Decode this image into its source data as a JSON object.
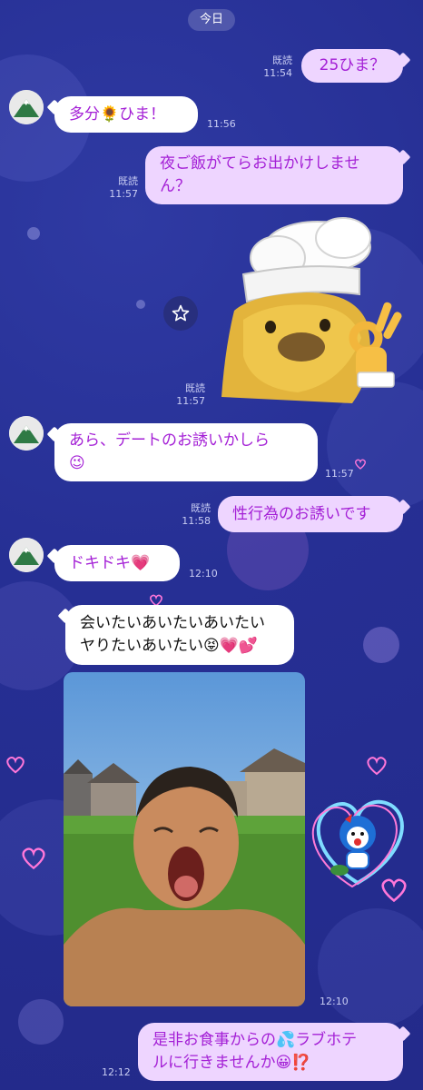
{
  "date_label": "今日",
  "messages": [
    {
      "side": "me",
      "text": "25ひま？",
      "read": "既読",
      "time": "11:54"
    },
    {
      "side": "them",
      "text": "多分🌻ひま！",
      "time": "11:56"
    },
    {
      "side": "me",
      "line1": "夜ご飯がてらお出かけしませ",
      "line2": "ん？",
      "read": "既読",
      "time": "11:57"
    },
    {
      "side": "me",
      "type": "sticker",
      "read": "既読",
      "time": "11:57"
    },
    {
      "side": "them",
      "line1": "あら、デートのお誘いかしら",
      "line2": "😉",
      "time": "11:57"
    },
    {
      "side": "me",
      "text": "性行為のお誘いです",
      "read": "既読",
      "time": "11:58"
    },
    {
      "side": "them",
      "text": "ドキドキ💗",
      "time": "12:10"
    },
    {
      "side": "them",
      "line1": "会いたいあいたいあいたい",
      "line2": "ヤりたいあいたい😝💗💕"
    },
    {
      "side": "them",
      "type": "photo",
      "time": "12:10"
    },
    {
      "side": "me",
      "line1": "是非お食事からの💦ラブホテ",
      "line2": "ルに行きませんか😀⁉️",
      "time": "12:12"
    }
  ],
  "icons": {
    "avatar": "mountain-avatar-icon",
    "favorite": "star-icon"
  },
  "colors": {
    "background": "#262f94",
    "my_bubble": "#eed5ff",
    "text_accent": "#a420d6"
  }
}
